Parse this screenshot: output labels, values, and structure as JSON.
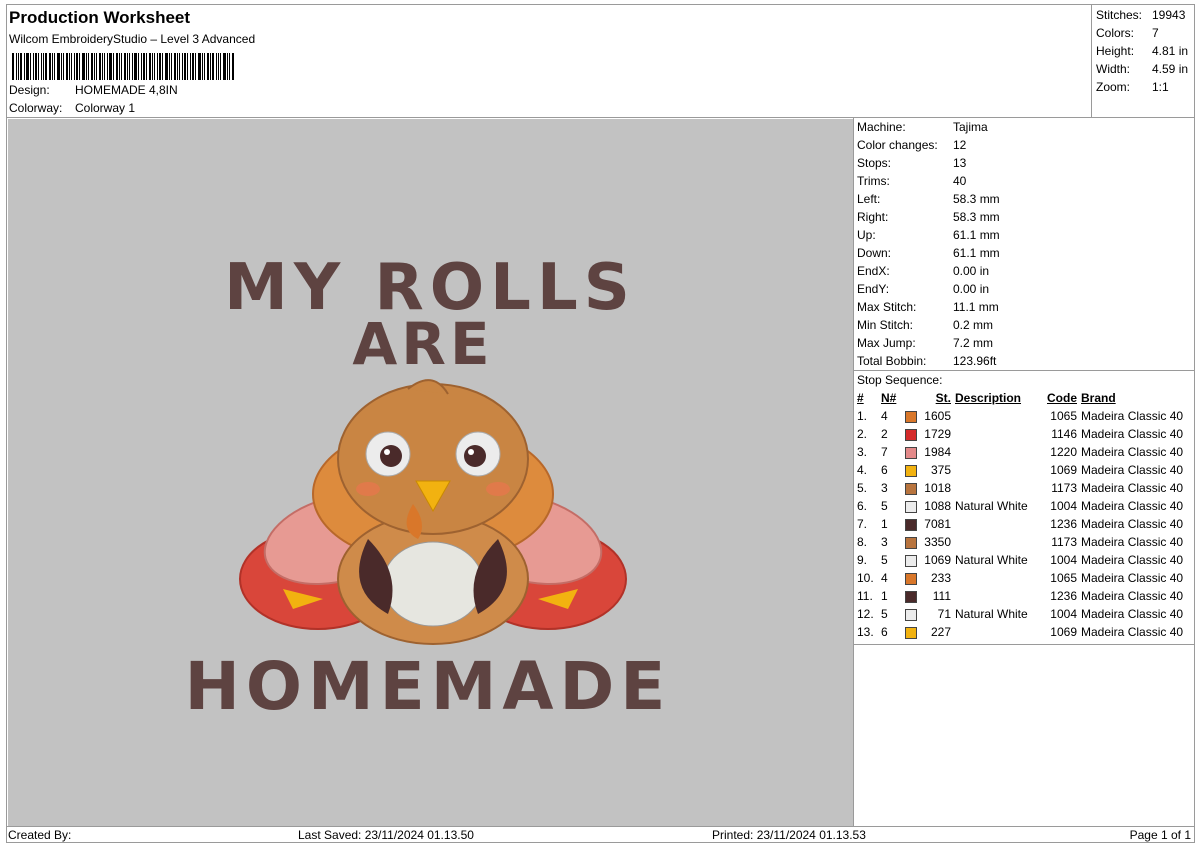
{
  "header": {
    "title": "Production Worksheet",
    "software": "Wilcom EmbroideryStudio – Level 3 Advanced",
    "design_label": "Design:",
    "design_value": "HOMEMADE 4,8IN",
    "colorway_label": "Colorway:",
    "colorway_value": "Colorway 1"
  },
  "stats": [
    {
      "label": "Stitches:",
      "value": "19943"
    },
    {
      "label": "Colors:",
      "value": "7"
    },
    {
      "label": "Height:",
      "value": "4.81 in"
    },
    {
      "label": "Width:",
      "value": "4.59 in"
    },
    {
      "label": "Zoom:",
      "value": "1:1"
    }
  ],
  "machine": [
    {
      "label": "Machine:",
      "value": "Tajima"
    },
    {
      "label": "Color changes:",
      "value": "12"
    },
    {
      "label": "Stops:",
      "value": "13"
    },
    {
      "label": "Trims:",
      "value": "40"
    },
    {
      "label": "Left:",
      "value": "58.3 mm"
    },
    {
      "label": "Right:",
      "value": "58.3 mm"
    },
    {
      "label": "Up:",
      "value": "61.1 mm"
    },
    {
      "label": "Down:",
      "value": "61.1 mm"
    },
    {
      "label": "EndX:",
      "value": "0.00 in"
    },
    {
      "label": "EndY:",
      "value": "0.00 in"
    },
    {
      "label": "Max Stitch:",
      "value": "11.1 mm"
    },
    {
      "label": "Min Stitch:",
      "value": "0.2 mm"
    },
    {
      "label": "Max Jump:",
      "value": "7.2 mm"
    },
    {
      "label": "Total Bobbin:",
      "value": "123.96ft"
    }
  ],
  "stop_sequence": {
    "title": "Stop Sequence:",
    "headers": {
      "num": "#",
      "n": "N#",
      "st": "St.",
      "desc": "Description",
      "code": "Code",
      "brand": "Brand"
    },
    "rows": [
      {
        "num": "1.",
        "n": "4",
        "color": "#d9772a",
        "st": "1605",
        "desc": "",
        "code": "1065",
        "brand": "Madeira Classic 40"
      },
      {
        "num": "2.",
        "n": "2",
        "color": "#d42a2a",
        "st": "1729",
        "desc": "",
        "code": "1146",
        "brand": "Madeira Classic 40"
      },
      {
        "num": "3.",
        "n": "7",
        "color": "#e48a8a",
        "st": "1984",
        "desc": "",
        "code": "1220",
        "brand": "Madeira Classic 40"
      },
      {
        "num": "4.",
        "n": "6",
        "color": "#f2b210",
        "st": "375",
        "desc": "",
        "code": "1069",
        "brand": "Madeira Classic 40"
      },
      {
        "num": "5.",
        "n": "3",
        "color": "#b8743e",
        "st": "1018",
        "desc": "",
        "code": "1173",
        "brand": "Madeira Classic 40"
      },
      {
        "num": "6.",
        "n": "5",
        "color": "#ececec",
        "st": "1088",
        "desc": "Natural White",
        "code": "1004",
        "brand": "Madeira Classic 40"
      },
      {
        "num": "7.",
        "n": "1",
        "color": "#4a2a2a",
        "st": "7081",
        "desc": "",
        "code": "1236",
        "brand": "Madeira Classic 40"
      },
      {
        "num": "8.",
        "n": "3",
        "color": "#b8743e",
        "st": "3350",
        "desc": "",
        "code": "1173",
        "brand": "Madeira Classic 40"
      },
      {
        "num": "9.",
        "n": "5",
        "color": "#ececec",
        "st": "1069",
        "desc": "Natural White",
        "code": "1004",
        "brand": "Madeira Classic 40"
      },
      {
        "num": "10.",
        "n": "4",
        "color": "#d9772a",
        "st": "233",
        "desc": "",
        "code": "1065",
        "brand": "Madeira Classic 40"
      },
      {
        "num": "11.",
        "n": "1",
        "color": "#4a2a2a",
        "st": "111",
        "desc": "",
        "code": "1236",
        "brand": "Madeira Classic 40"
      },
      {
        "num": "12.",
        "n": "5",
        "color": "#ececec",
        "st": "71",
        "desc": "Natural White",
        "code": "1004",
        "brand": "Madeira Classic 40"
      },
      {
        "num": "13.",
        "n": "6",
        "color": "#f2b210",
        "st": "227",
        "desc": "",
        "code": "1069",
        "brand": "Madeira Classic 40"
      }
    ]
  },
  "design_preview": {
    "line1": "MY ROLLS",
    "line2": "ARE",
    "line3": "HOMEMADE",
    "background": "#c2c2c2",
    "text_color": "#5e4341"
  },
  "footer": {
    "created_by": "Created By:",
    "last_saved": "Last Saved: 23/11/2024 01.13.50",
    "printed": "Printed: 23/11/2024 01.13.53",
    "page": "Page 1 of 1"
  }
}
